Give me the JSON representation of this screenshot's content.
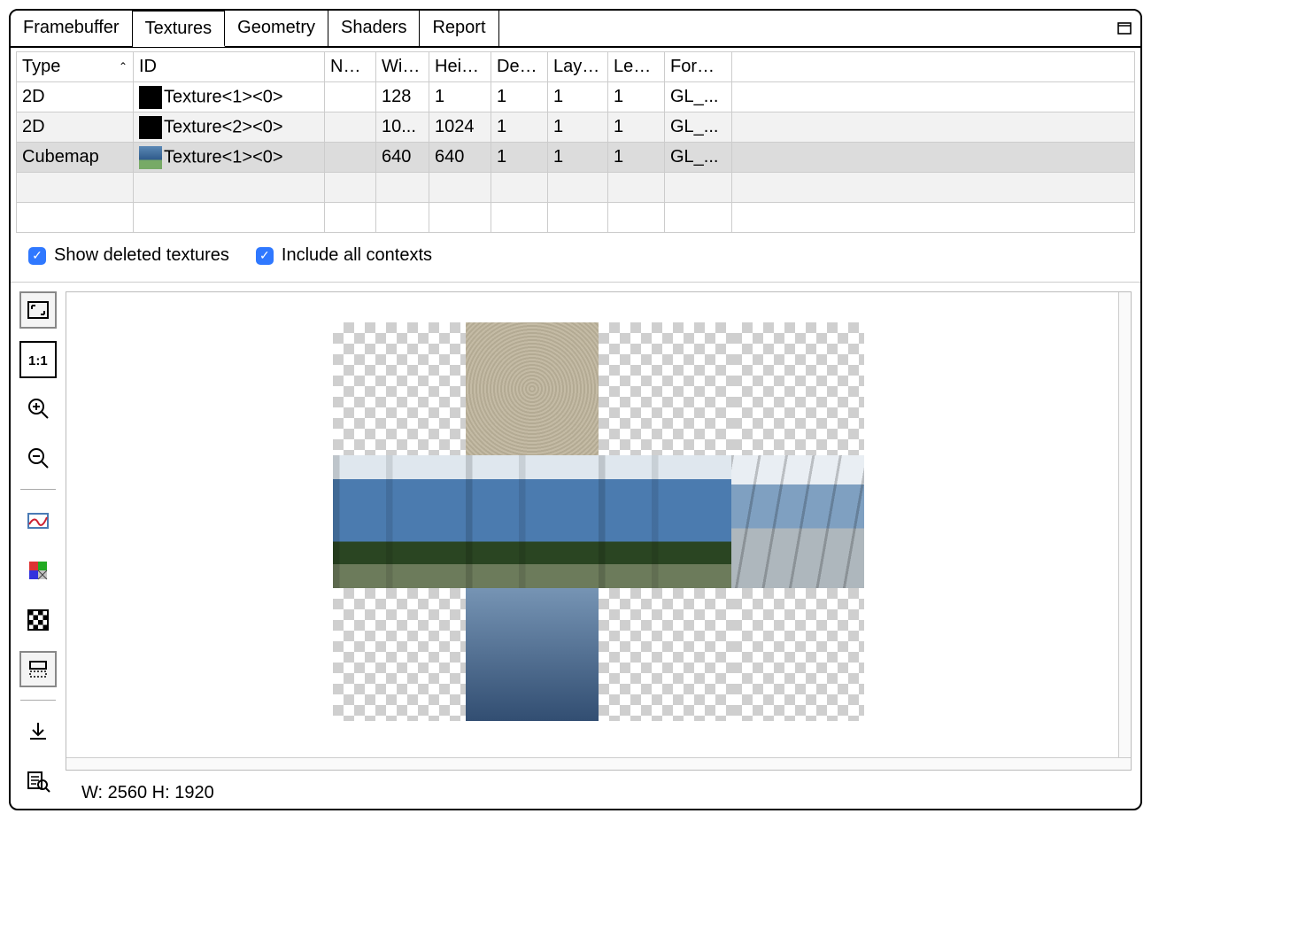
{
  "tabs": [
    "Framebuffer",
    "Textures",
    "Geometry",
    "Shaders",
    "Report"
  ],
  "active_tab": 1,
  "columns": [
    "Type",
    "ID",
    "Name",
    "Width",
    "Height",
    "Depth",
    "Layers",
    "Levels",
    "Format"
  ],
  "rows": [
    {
      "type": "2D",
      "id": "Texture<1><0>",
      "name": "",
      "width": "128",
      "height": "1",
      "depth": "1",
      "layers": "1",
      "levels": "1",
      "format": "GL_..."
    },
    {
      "type": "2D",
      "id": "Texture<2><0>",
      "name": "",
      "width": "10...",
      "height": "1024",
      "depth": "1",
      "layers": "1",
      "levels": "1",
      "format": "GL_..."
    },
    {
      "type": "Cubemap",
      "id": "Texture<1><0>",
      "name": "",
      "width": "640",
      "height": "640",
      "depth": "1",
      "layers": "1",
      "levels": "1",
      "format": "GL_..."
    }
  ],
  "checks": {
    "show_deleted": "Show deleted textures",
    "include_all": "Include all contexts"
  },
  "dims": {
    "label": "W: 2560 H: 1920"
  }
}
